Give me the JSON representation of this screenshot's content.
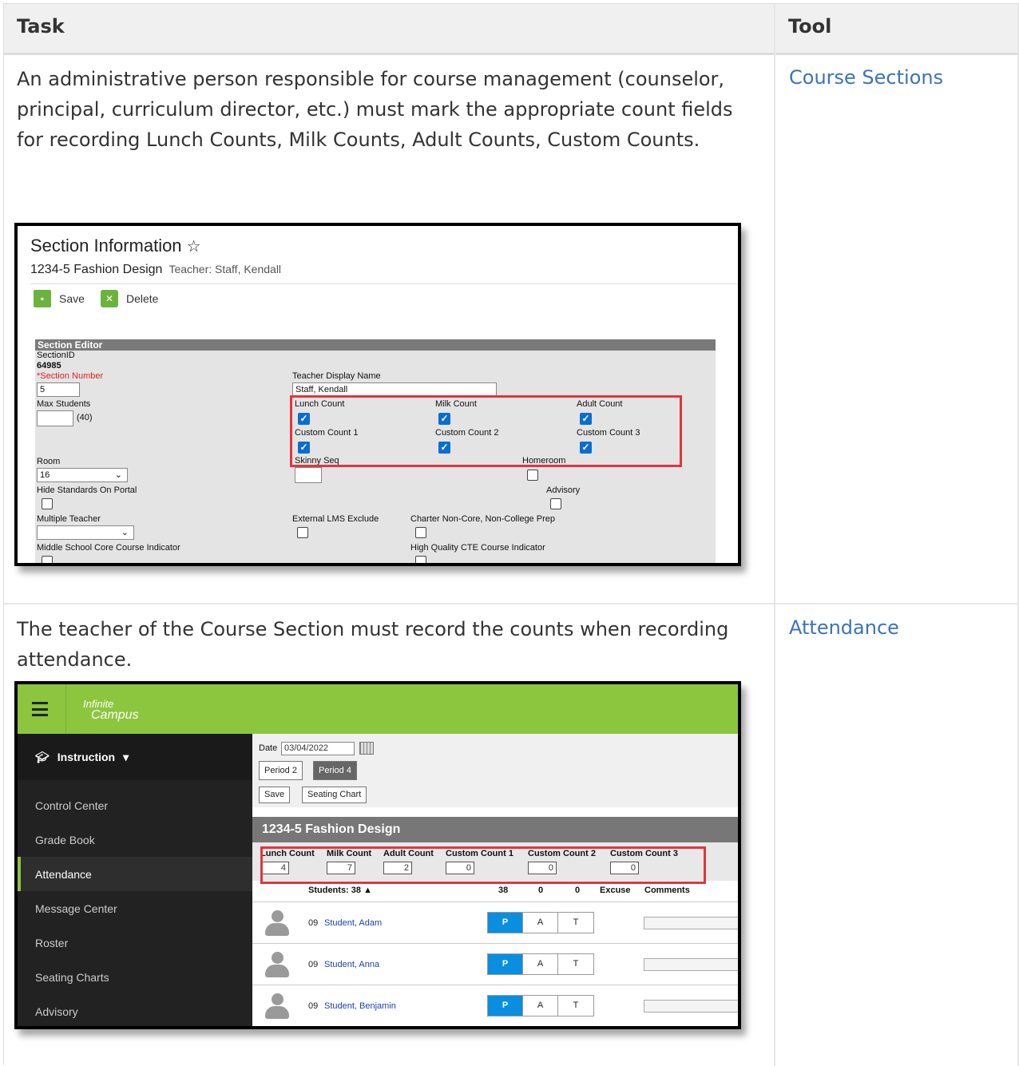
{
  "table": {
    "headers": {
      "task": "Task",
      "tool": "Tool"
    },
    "rows": [
      {
        "task": "An administrative person responsible for course management (counselor, principal, curriculum director, etc.) must mark the appropriate count fields for recording Lunch Counts, Milk Counts, Adult Counts, Custom Counts.",
        "tool": "Course Sections"
      },
      {
        "task": "The teacher of the Course Section must record the counts when recording attendance.",
        "tool": "Attendance"
      }
    ]
  },
  "section_info": {
    "title": "Section Information",
    "course": "1234-5 Fashion Design",
    "teacher": "Teacher: Staff, Kendall",
    "save_label": "Save",
    "delete_label": "Delete",
    "editor_title": "Section Editor",
    "section_id_label": "SectionID",
    "section_id": "64985",
    "section_number_label": "*Section Number",
    "section_number": "5",
    "max_students_label": "Max Students",
    "max_students_hint": "(40)",
    "teacher_display_label": "Teacher Display Name",
    "teacher_display_value": "Staff, Kendall",
    "counts": [
      {
        "label": "Lunch Count",
        "checked": true
      },
      {
        "label": "Milk Count",
        "checked": true
      },
      {
        "label": "Adult Count",
        "checked": true
      },
      {
        "label": "Custom Count 1",
        "checked": true
      },
      {
        "label": "Custom Count 2",
        "checked": true
      },
      {
        "label": "Custom Count 3",
        "checked": true
      }
    ],
    "skinny_seq_label": "Skinny Seq",
    "homeroom_label": "Homeroom",
    "room_label": "Room",
    "room_value": "16",
    "hide_standards_label": "Hide Standards On Portal",
    "advisory_label": "Advisory",
    "multiple_teacher_label": "Multiple Teacher",
    "external_lms_label": "External LMS Exclude",
    "charter_label": "Charter Non-Core, Non-College Prep",
    "middle_school_label": "Middle School Core Course Indicator",
    "high_quality_cte_label": "High Quality CTE Course Indicator"
  },
  "attendance": {
    "logo_line1": "Infinite",
    "logo_line2": "Campus",
    "nav_header": "Instruction",
    "nav_items": [
      "Control Center",
      "Grade Book",
      "Attendance",
      "Message Center",
      "Roster",
      "Seating Charts",
      "Advisory"
    ],
    "active_item": "Attendance",
    "date_label": "Date",
    "date_value": "03/04/2022",
    "periods": [
      "Period 2",
      "Period 4"
    ],
    "save_label": "Save",
    "seating_chart_label": "Seating Chart",
    "section_title": "1234-5 Fashion Design",
    "counts": [
      {
        "label": "Lunch Count",
        "value": "4"
      },
      {
        "label": "Milk Count",
        "value": "7"
      },
      {
        "label": "Adult Count",
        "value": "2"
      },
      {
        "label": "Custom Count 1",
        "value": "0"
      },
      {
        "label": "Custom Count 2",
        "value": "0"
      },
      {
        "label": "Custom Count 3",
        "value": "0"
      }
    ],
    "students_header": "Students: 38",
    "present_total": "38",
    "absent_total": "0",
    "tardy_total": "0",
    "excuse_label": "Excuse",
    "comments_label": "Comments",
    "pat_labels": [
      "P",
      "A",
      "T"
    ],
    "students": [
      {
        "grade": "09",
        "name": "Student, Adam"
      },
      {
        "grade": "09",
        "name": "Student, Anna"
      },
      {
        "grade": "09",
        "name": "Student, Benjamin"
      }
    ]
  },
  "colors": {
    "link": "#3b73b9",
    "green": "#8cc63f",
    "highlight": "#e2353d",
    "check": "#0a6ed1",
    "present": "#0a8ee0"
  }
}
